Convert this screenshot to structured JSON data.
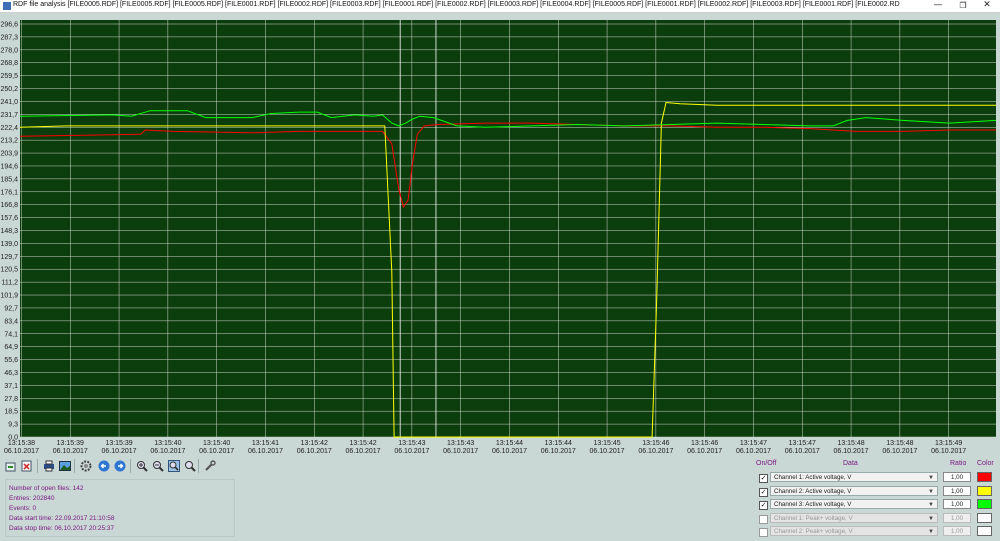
{
  "window": {
    "title": "RDF file analysis [FILE0005.RDF] [FILE0005.RDF] [FILE0005.RDF] [FILE0001.RDF] [FILE0002.RDF] [FILE0003.RDF] [FILE0001.RDF] [FILE0002.RDF] [FILE0003.RDF] [FILE0004.RDF] [FILE0005.RDF] [FILE0001.RDF] [FILE0002.RDF] [FILE0003.RDF] [FILE0001.RDF] [FILE0002.RD",
    "minimize": "—",
    "restore": "❐",
    "close": "✕"
  },
  "chart_data": {
    "type": "line",
    "background": "#0c3d0c",
    "grid": true,
    "ylim": [
      0,
      300
    ],
    "yticks": [
      "296,6",
      "287,3",
      "278,0",
      "268,8",
      "259,5",
      "250,2",
      "241,0",
      "231,7",
      "222,4",
      "213,2",
      "203,9",
      "194,6",
      "185,4",
      "176,1",
      "166,8",
      "157,6",
      "148,3",
      "139,0",
      "129,7",
      "120,5",
      "111,2",
      "101,9",
      "92,7",
      "83,4",
      "74,1",
      "64,9",
      "55,6",
      "46,3",
      "37,1",
      "27,8",
      "18,5",
      "9,3",
      "0,0"
    ],
    "xlim": [
      0,
      21
    ],
    "xticks": [
      {
        "time": "13:15:38",
        "date": "06.10.2017"
      },
      {
        "time": "13:15:39",
        "date": "06.10.2017"
      },
      {
        "time": "13:15:39",
        "date": "06.10.2017"
      },
      {
        "time": "13:15:40",
        "date": "06.10.2017"
      },
      {
        "time": "13:15:40",
        "date": "06.10.2017"
      },
      {
        "time": "13:15:41",
        "date": "06.10.2017"
      },
      {
        "time": "13:15:42",
        "date": "06.10.2017"
      },
      {
        "time": "13:15:42",
        "date": "06.10.2017"
      },
      {
        "time": "13:15:43",
        "date": "06.10.2017"
      },
      {
        "time": "13:15:43",
        "date": "06.10.2017"
      },
      {
        "time": "13:15:44",
        "date": "06.10.2017"
      },
      {
        "time": "13:15:44",
        "date": "06.10.2017"
      },
      {
        "time": "13:15:45",
        "date": "06.10.2017"
      },
      {
        "time": "13:15:46",
        "date": "06.10.2017"
      },
      {
        "time": "13:15:46",
        "date": "06.10.2017"
      },
      {
        "time": "13:15:47",
        "date": "06.10.2017"
      },
      {
        "time": "13:15:47",
        "date": "06.10.2017"
      },
      {
        "time": "13:15:48",
        "date": "06.10.2017"
      },
      {
        "time": "13:15:48",
        "date": "06.10.2017"
      },
      {
        "time": "13:15:49",
        "date": "06.10.2017"
      }
    ],
    "series": [
      {
        "color": "#ff0000",
        "points": [
          [
            0,
            218.5
          ],
          [
            2,
            219.5
          ],
          [
            2.6,
            220
          ],
          [
            2.7,
            223
          ],
          [
            3.3,
            222
          ],
          [
            5,
            221
          ],
          [
            6,
            222
          ],
          [
            7,
            222
          ],
          [
            7.8,
            222
          ],
          [
            8.0,
            213
          ],
          [
            8.15,
            180
          ],
          [
            8.25,
            167
          ],
          [
            8.35,
            172
          ],
          [
            8.45,
            200
          ],
          [
            8.55,
            220
          ],
          [
            8.7,
            226
          ],
          [
            9,
            227
          ],
          [
            10,
            228
          ],
          [
            11,
            228
          ],
          [
            12,
            227
          ],
          [
            13,
            226
          ],
          [
            14,
            226
          ],
          [
            15,
            225
          ],
          [
            16,
            225
          ],
          [
            17,
            224
          ],
          [
            18,
            222
          ],
          [
            19,
            222
          ],
          [
            20,
            223
          ],
          [
            21,
            223
          ]
        ]
      },
      {
        "color": "#ffff00",
        "points": [
          [
            0,
            225
          ],
          [
            1,
            226
          ],
          [
            2,
            226
          ],
          [
            3,
            226
          ],
          [
            4,
            226
          ],
          [
            5,
            226
          ],
          [
            6,
            226
          ],
          [
            7,
            226
          ],
          [
            7.85,
            226
          ],
          [
            8.0,
            120
          ],
          [
            8.05,
            0
          ],
          [
            13.6,
            0
          ],
          [
            13.7,
            100
          ],
          [
            13.8,
            228
          ],
          [
            13.9,
            243
          ],
          [
            14.2,
            242
          ],
          [
            15,
            241
          ],
          [
            16,
            241
          ],
          [
            17,
            241
          ],
          [
            18,
            241
          ],
          [
            19,
            241
          ],
          [
            20,
            241
          ],
          [
            21,
            241
          ]
        ]
      },
      {
        "color": "#00ff00",
        "points": [
          [
            0,
            233
          ],
          [
            2,
            234
          ],
          [
            2.4,
            233
          ],
          [
            2.8,
            237
          ],
          [
            3.6,
            237
          ],
          [
            4,
            232
          ],
          [
            5,
            232
          ],
          [
            5.4,
            235
          ],
          [
            6,
            236
          ],
          [
            6.4,
            236
          ],
          [
            6.7,
            232
          ],
          [
            7.2,
            234
          ],
          [
            7.6,
            233
          ],
          [
            7.8,
            234
          ],
          [
            8.0,
            228
          ],
          [
            8.15,
            226
          ],
          [
            8.3,
            228
          ],
          [
            8.45,
            231
          ],
          [
            8.6,
            233
          ],
          [
            8.9,
            232
          ],
          [
            9.4,
            226
          ],
          [
            10,
            225
          ],
          [
            11,
            226
          ],
          [
            12,
            227
          ],
          [
            13,
            226
          ],
          [
            14,
            227
          ],
          [
            15,
            228
          ],
          [
            16,
            227
          ],
          [
            17,
            226
          ],
          [
            17.5,
            226
          ],
          [
            17.8,
            230
          ],
          [
            18.2,
            232
          ],
          [
            19,
            230
          ],
          [
            20,
            228
          ],
          [
            21,
            230
          ]
        ]
      }
    ]
  },
  "toolbar": {
    "buttons": [
      {
        "name": "open-file-button",
        "icon": "open-file-icon"
      },
      {
        "name": "close-file-button",
        "icon": "close-file-icon"
      },
      {
        "name": "print-button",
        "icon": "print-icon"
      },
      {
        "name": "export-image-button",
        "icon": "image-icon"
      },
      {
        "name": "settings-button",
        "icon": "gear-icon"
      },
      {
        "name": "back-button",
        "icon": "arrow-left-icon"
      },
      {
        "name": "forward-button",
        "icon": "arrow-right-icon"
      },
      {
        "name": "zoom-in-button",
        "icon": "zoom-in-icon"
      },
      {
        "name": "zoom-out-button",
        "icon": "zoom-out-icon"
      },
      {
        "name": "zoom-area-button",
        "icon": "zoom-area-icon"
      },
      {
        "name": "zoom-reset-button",
        "icon": "zoom-reset-icon"
      },
      {
        "name": "measure-button",
        "icon": "wrench-icon"
      }
    ]
  },
  "info": {
    "files": "Number of open files: 142",
    "entries": "Entries: 202840",
    "events": "Events: 0",
    "start": "Data start time: 22.09.2017 21:10:58",
    "stop": "Data stop time: 06.10.2017 20:25:37"
  },
  "panel": {
    "onoff": "On/Off",
    "data": "Data",
    "ratio": "Ratio",
    "color": "Color",
    "channels": [
      {
        "checked": true,
        "check": "✓",
        "label": "Channel 1: Active voltage, V",
        "ratio": "1,00",
        "color": "#ff0000",
        "enabled": true
      },
      {
        "checked": true,
        "check": "✓",
        "label": "Channel 2: Active voltage, V",
        "ratio": "1,00",
        "color": "#ffff00",
        "enabled": true
      },
      {
        "checked": true,
        "check": "✓",
        "label": "Channel 3: Active voltage, V",
        "ratio": "1,00",
        "color": "#00ff00",
        "enabled": true
      },
      {
        "checked": false,
        "check": "",
        "label": "Channel 1: Peak+ voltage, V",
        "ratio": "1,00",
        "color": "#ffffff",
        "enabled": false
      },
      {
        "checked": false,
        "check": "",
        "label": "Channel 2: Peak+ voltage, V",
        "ratio": "1,00",
        "color": "#ffffff",
        "enabled": false
      }
    ]
  }
}
